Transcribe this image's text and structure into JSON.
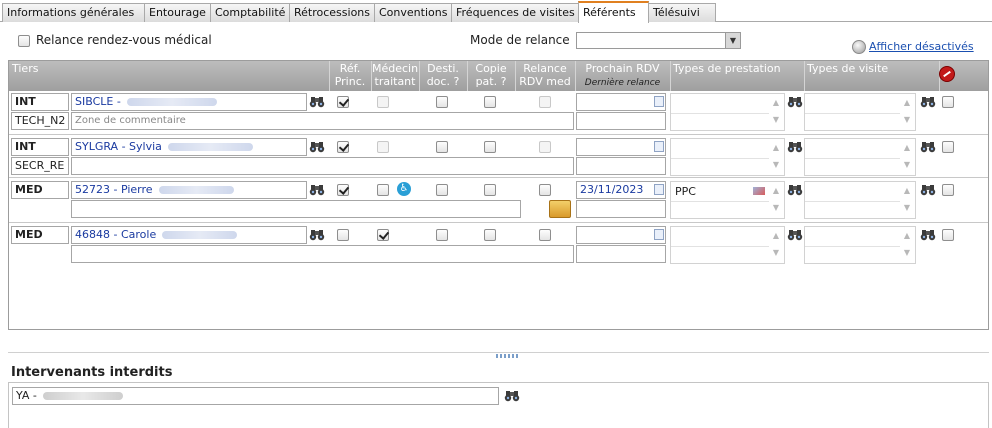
{
  "tabs": [
    {
      "label": "Informations générales"
    },
    {
      "label": "Entourage"
    },
    {
      "label": "Comptabilité"
    },
    {
      "label": "Rétrocessions"
    },
    {
      "label": "Conventions"
    },
    {
      "label": "Fréquences de visites"
    },
    {
      "label": "Référents",
      "active": true
    },
    {
      "label": "Télésuivi"
    }
  ],
  "options": {
    "relance_label": "Relance rendez-vous médical",
    "relance_checked": false,
    "mode_label": "Mode de relance",
    "mode_value": "",
    "afficher_label": "Afficher désactivés"
  },
  "grid": {
    "headers": {
      "tiers": "Tiers",
      "ref_princ_1": "Réf.",
      "ref_princ_2": "Princ.",
      "medecin_1": "Médecin",
      "medecin_2": "traitant",
      "desti_1": "Desti.",
      "desti_2": "doc. ?",
      "copie_1": "Copie",
      "copie_2": "pat. ?",
      "relance_1": "Relance",
      "relance_2": "RDV med",
      "prochain": "Prochain RDV",
      "derniere": "Dernière relance",
      "types_prestation": "Types de prestation",
      "types_visite": "Types de visite"
    },
    "rows": [
      {
        "type": "INT",
        "name": "SIBCLE  -",
        "sub": "TECH_N2",
        "comment_placeholder": "Zone de commentaire",
        "comment": "",
        "ref": true,
        "med": false,
        "med_disabled": true,
        "desti": false,
        "copie": false,
        "relance": false,
        "relance_disabled": true,
        "date": "",
        "prestation": ""
      },
      {
        "type": "INT",
        "name": "SYLGRA  - Sylvia",
        "sub": "SECR_RE",
        "comment_placeholder": "",
        "comment": "",
        "ref": true,
        "med": false,
        "med_disabled": true,
        "desti": false,
        "copie": false,
        "relance": false,
        "relance_disabled": true,
        "date": "",
        "prestation": ""
      },
      {
        "type": "MED",
        "name": "52723  - Pierre",
        "sub": "",
        "comment_placeholder": "",
        "comment": "",
        "ref": true,
        "med": false,
        "med_disabled": false,
        "desti": false,
        "copie": false,
        "relance": false,
        "relance_disabled": false,
        "date": "23/11/2023",
        "prestation": "PPC"
      },
      {
        "type": "MED",
        "name": "46848  - Carole",
        "sub": "",
        "comment_placeholder": "",
        "comment": "",
        "ref": false,
        "med": true,
        "med_disabled": false,
        "desti": false,
        "copie": false,
        "relance": false,
        "relance_disabled": false,
        "date": "",
        "prestation": ""
      }
    ]
  },
  "interdits": {
    "title": "Intervenants interdits",
    "value": "YA -"
  },
  "icons": {
    "binoculars": "binoculars-icon",
    "disabled_filter": "no-entry-icon",
    "wheelchair": "wheelchair-icon",
    "package": "package-icon",
    "calendar": "calendar-icon",
    "eraser": "eraser-icon",
    "globe": "globe-icon"
  },
  "colors": {
    "tab_active_accent": "#e08020",
    "header_bg": "#a8a8a8",
    "link": "#1a4fb0",
    "name_text": "#1a3aa0"
  }
}
